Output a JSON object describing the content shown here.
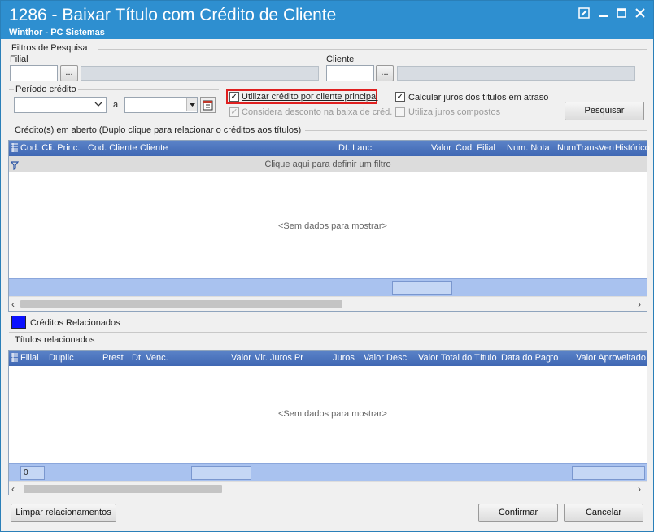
{
  "window": {
    "title": "1286 - Baixar Título com Crédito de Cliente",
    "subtitle": "Winthor - PC Sistemas"
  },
  "filters": {
    "group_label": "Filtros de Pesquisa",
    "filial_label": "Filial",
    "cliente_label": "Cliente",
    "ellipsis": "...",
    "periodo_label": "Período crédito",
    "a_label": "a",
    "chk_utilizar_credito": "Utilizar crédito por cliente principal",
    "chk_considera_desconto": "Considera desconto na baixa de créd.",
    "chk_calcular_juros": "Calcular juros dos títulos em atraso",
    "chk_juros_compostos": "Utiliza juros compostos",
    "pesquisar": "Pesquisar"
  },
  "creditos": {
    "group_label": "Crédito(s) em aberto  (Duplo clique para relacionar o créditos aos títulos)",
    "columns": [
      "Cod. Cli. Princ.",
      "Cod. Cliente",
      "Cliente",
      "Dt. Lanc",
      "Valor",
      "Cod. Filial",
      "Num. Nota",
      "NumTransVen",
      "Histórico"
    ],
    "filter_text": "Clique aqui para definir um filtro",
    "no_data": "<Sem dados para mostrar>",
    "legend_label": "Créditos Relacionados",
    "legend_color": "#0a10ff"
  },
  "titulos": {
    "group_label": "Títulos relacionados",
    "columns": [
      "Filial",
      "Duplic",
      "Prest",
      "Dt. Venc.",
      "Valor",
      "Vlr. Juros Pr",
      "Juros",
      "Valor Desc.",
      "Valor Total do Título",
      "Data do Pagto",
      "Valor Aproveitado"
    ],
    "no_data": "<Sem dados para mostrar>",
    "footer_count": "0"
  },
  "actions": {
    "limpar": "Limpar relacionamentos",
    "confirmar": "Confirmar",
    "cancelar": "Cancelar"
  },
  "colors": {
    "titlebar": "#2e8fd0",
    "grid_header": "#4a72bd",
    "highlight_box": "#e02020"
  }
}
